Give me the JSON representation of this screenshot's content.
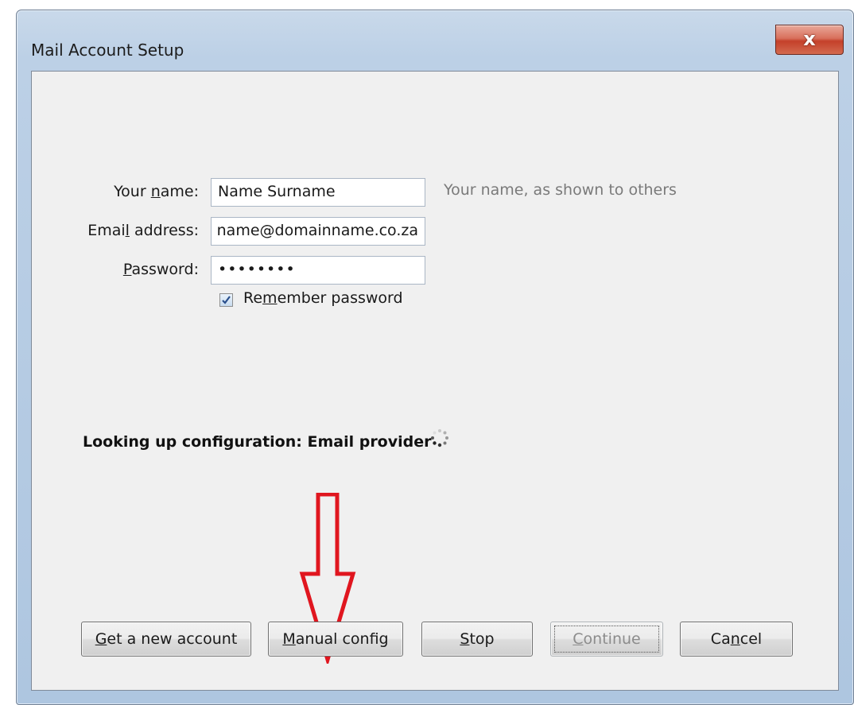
{
  "window": {
    "title": "Mail Account Setup",
    "close_glyph": "x"
  },
  "form": {
    "name": {
      "label_pre": "Your ",
      "label_key": "n",
      "label_post": "ame:",
      "value": "Name Surname",
      "hint": "Your name, as shown to others"
    },
    "email": {
      "label_pre": "Emai",
      "label_key": "l",
      "label_post": " address:",
      "value": "name@domainname.co.za"
    },
    "password": {
      "label_pre": "",
      "label_key": "P",
      "label_post": "assword:",
      "value_masked": "••••••••"
    },
    "remember": {
      "label_pre": "Re",
      "label_key": "m",
      "label_post": "ember password",
      "checked": true
    }
  },
  "status": {
    "text": "Looking up configuration: Email provider",
    "spinner_icon": "loading-spinner-icon"
  },
  "annotation": {
    "arrow_icon": "red-down-arrow-icon",
    "arrow_color": "#e0161f"
  },
  "buttons": {
    "get_new": {
      "key": "G",
      "rest": "et a new account"
    },
    "manual": {
      "key": "M",
      "rest": "anual config"
    },
    "stop": {
      "key": "S",
      "rest": "top"
    },
    "continue": {
      "key": "C",
      "rest": "ontinue",
      "disabled": true
    },
    "cancel": {
      "pre": "Ca",
      "key": "n",
      "rest": "cel"
    }
  }
}
